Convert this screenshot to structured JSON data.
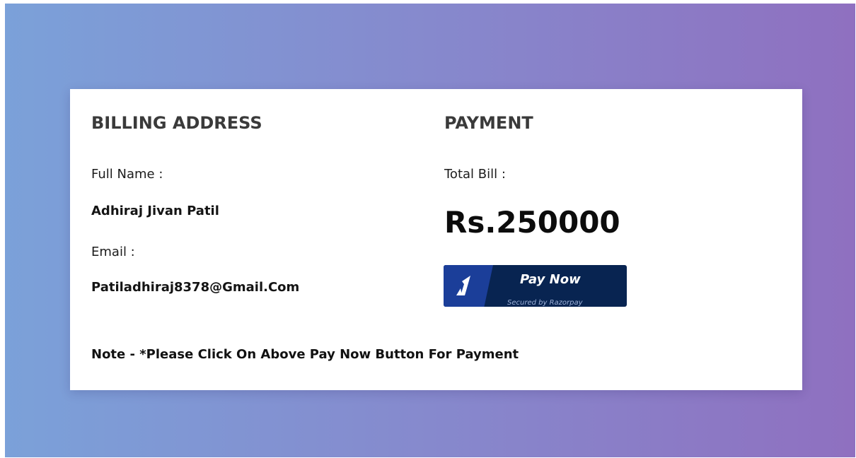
{
  "billing": {
    "heading": "BILLING ADDRESS",
    "full_name_label": "Full Name :",
    "full_name": "Adhiraj Jivan Patil",
    "email_label": "Email :",
    "email": "Patiladhiraj8378@Gmail.Com"
  },
  "payment": {
    "heading": "PAYMENT",
    "total_label": "Total Bill :",
    "total_amount": "Rs.250000",
    "pay_button": {
      "label": "Pay Now",
      "subtext": "Secured by Razorpay",
      "icon": "razorpay-icon",
      "background_color": "#082451",
      "icon_panel_color": "#1b3e99"
    }
  },
  "note": "Note - *Please Click On Above Pay Now Button For Payment",
  "colors": {
    "gradient_start": "#7ba1d9",
    "gradient_end": "#8f70c0",
    "card": "#ffffff"
  }
}
